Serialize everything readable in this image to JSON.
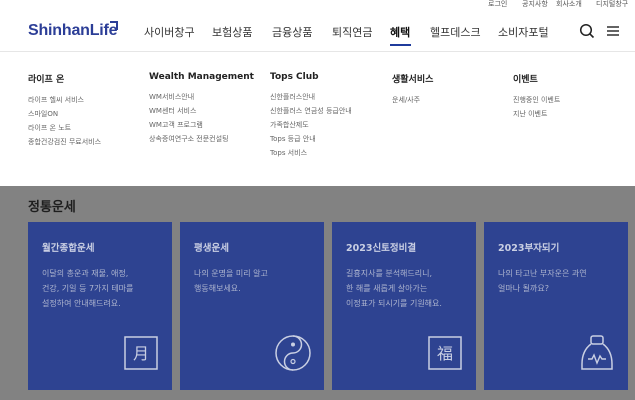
{
  "utility": {
    "links": [
      "로그인",
      "공지사항",
      "회사소개",
      "디지털창구"
    ]
  },
  "header": {
    "logo_text": "ShinhanLife",
    "nav": [
      "사이버창구",
      "보험상품",
      "금융상품",
      "퇴직연금",
      "혜택",
      "헬프데스크",
      "소비자포털"
    ],
    "active_nav": "혜택"
  },
  "menu": {
    "columns": [
      {
        "title": "라이프 온",
        "items": [
          "라이프 헬씨 서비스",
          "스마일ON",
          "라이프 온 노트",
          "종합건강검진 무료서비스"
        ]
      },
      {
        "title": "Wealth Management",
        "items": [
          "WM서비스안내",
          "WM센터 서비스",
          "WM고객 프로그램",
          "상속증여연구소 전문컨설팅"
        ]
      },
      {
        "title": "Tops Club",
        "items": [
          "신한플러스안내",
          "신한플러스 연금성 등급안내",
          "가족합산제도",
          "Tops 등급 안내",
          "Tops 서비스"
        ]
      },
      {
        "title": "생활서비스",
        "items": [
          "운세/사주"
        ]
      },
      {
        "title": "이벤트",
        "items": [
          "진행중인 이벤트",
          "지난 이벤트"
        ]
      }
    ]
  },
  "fortune": {
    "section_title": "정통운세",
    "cards": [
      {
        "title": "월간종합운세",
        "lines": [
          "이달의 총운과 재물, 애정,",
          "건강, 기일 등 7가지 테마를",
          "설정하여 안내해드려요."
        ],
        "icon": "calendar-month-icon",
        "glyph": "月"
      },
      {
        "title": "평생운세",
        "lines": [
          "나의 운명을 미리 알고",
          "행동해보세요."
        ],
        "icon": "yin-yang-icon",
        "glyph": ""
      },
      {
        "title": "2023신토정비결",
        "lines": [
          "길흉지사를 분석해드리니,",
          "한 해를 새롭게 살아가는",
          "이정표가 되시기를 기원해요."
        ],
        "icon": "fortune-blessing-icon",
        "glyph": "福"
      },
      {
        "title": "2023부자되기",
        "lines": [
          "나의 타고난 부자운은 과연",
          "얼마나 될까요?"
        ],
        "icon": "money-pouch-icon",
        "glyph": ""
      }
    ]
  },
  "colors": {
    "brand": "#2c3e97",
    "card": "#2e4391",
    "overlay": "#828282"
  }
}
